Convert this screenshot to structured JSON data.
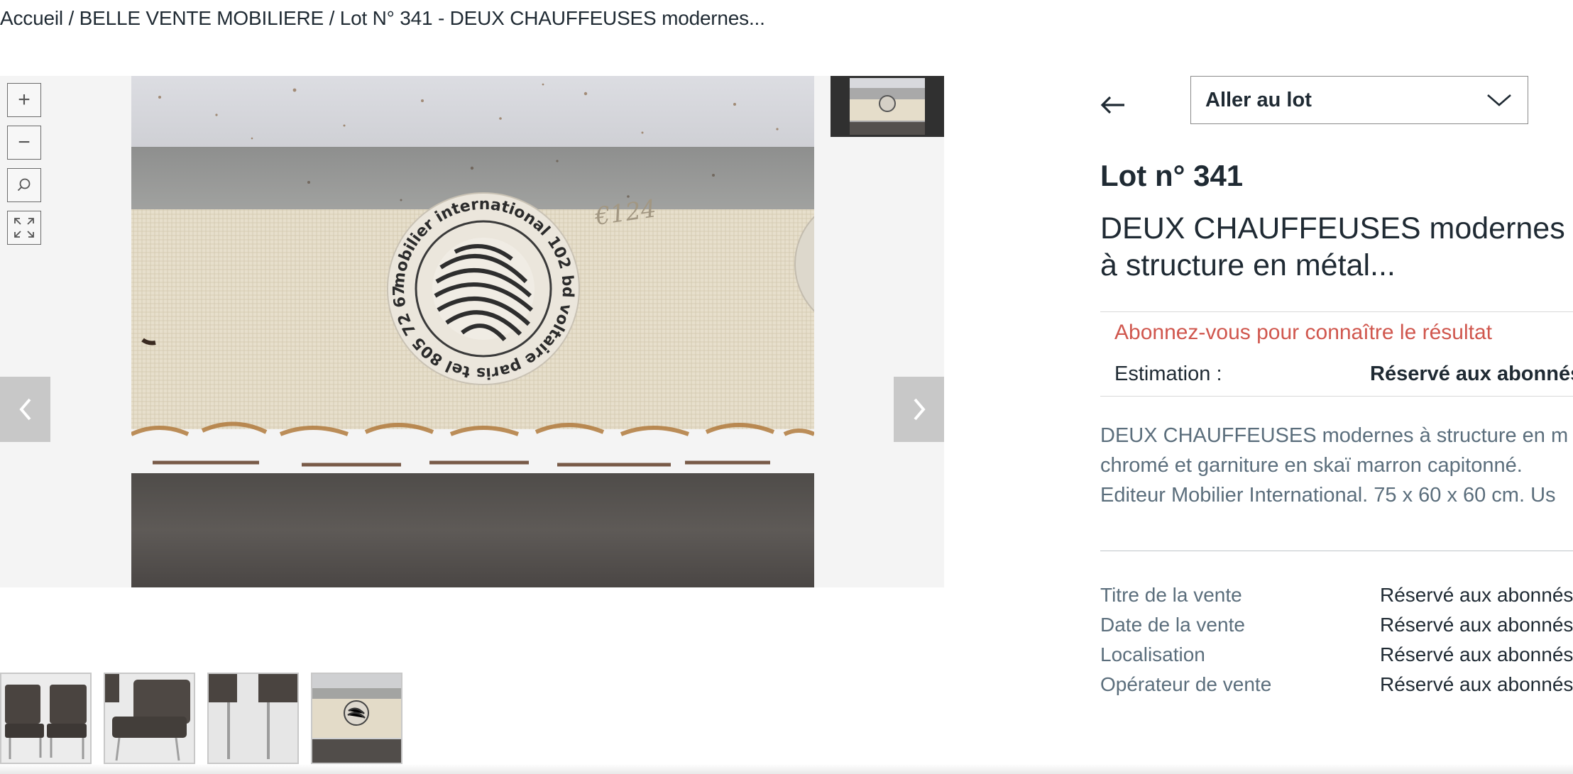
{
  "breadcrumb": {
    "home": "Accueil",
    "sale": "BELLE VENTE MOBILIERE",
    "lot": "Lot N°  341 - DEUX CHAUFFEUSES modernes...",
    "separator": " / "
  },
  "viewer": {
    "zoom_in_symbol": "+",
    "zoom_out_symbol": "−",
    "icons": [
      "zoom-in-icon",
      "zoom-out-icon",
      "search-icon",
      "fullscreen-icon",
      "chevron-left-icon",
      "chevron-right-icon"
    ],
    "photo_label_text": "mobilier international 102 bd voltaire paris tel 805 72 67",
    "photo_scribble": "€124",
    "thumbnails": [
      "chairs-front",
      "chair-detail",
      "chair-legs",
      "label-detail"
    ]
  },
  "goto": {
    "label": "Aller au lot",
    "icon": "chevron-down-icon"
  },
  "lot": {
    "number": "Lot n° 341",
    "title": "DEUX CHAUFFEUSES modernes à structure en métal..."
  },
  "result": {
    "subscribe_text": "Abonnez-vous pour connaître le résultat",
    "estimation_label": "Estimation :",
    "estimation_value": "Réservé aux abonnés"
  },
  "description": {
    "line1": "DEUX CHAUFFEUSES modernes à structure en m",
    "line2": "chromé et garniture en skaï marron capitonné.",
    "line3": "Editeur Mobilier International. 75 x 60 x 60 cm. Us"
  },
  "info": [
    {
      "key": "Titre de la vente",
      "value": "Réservé aux abonnés"
    },
    {
      "key": "Date de la vente",
      "value": "Réservé aux abonnés"
    },
    {
      "key": "Localisation",
      "value": "Réservé aux abonnés"
    },
    {
      "key": "Opérateur de vente",
      "value": "Réservé aux abonnés"
    }
  ],
  "colors": {
    "text": "#1f2a33",
    "muted": "#5b6e7c",
    "alert": "#d0574e",
    "viewer_bg": "#f4f4f4"
  }
}
